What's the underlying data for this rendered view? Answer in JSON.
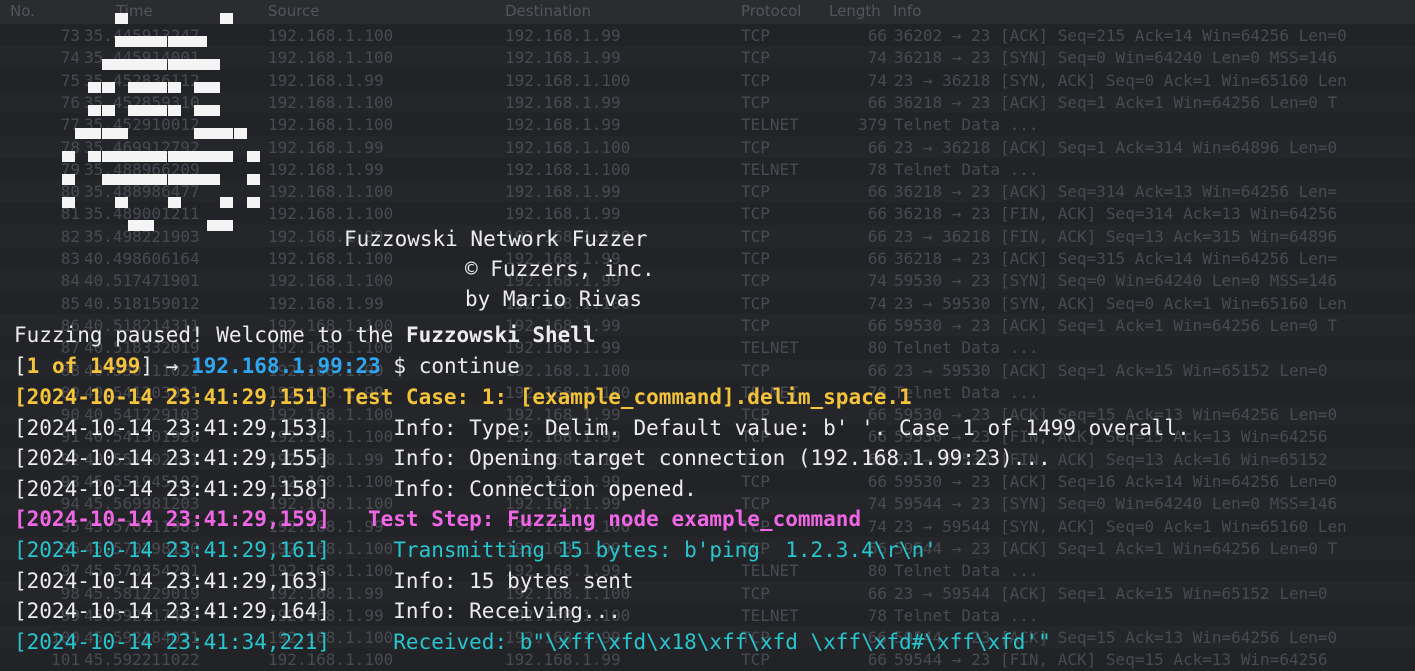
{
  "background": {
    "columns": [
      "No.",
      "Time",
      "Source",
      "Destination",
      "Protocol",
      "Length",
      "Info"
    ],
    "rows": [
      {
        "no": "73",
        "time": "35.445913247",
        "src": "192.168.1.100",
        "dst": "192.168.1.99",
        "proto": "TCP",
        "len": "66",
        "info": "36202 → 23 [ACK] Seq=215 Ack=14 Win=64256 Len=0"
      },
      {
        "no": "74",
        "time": "35.445914001",
        "src": "192.168.1.100",
        "dst": "192.168.1.99",
        "proto": "TCP",
        "len": "74",
        "info": "36218 → 23 [SYN] Seq=0 Win=64240 Len=0 MSS=146"
      },
      {
        "no": "75",
        "time": "35.452836112",
        "src": "192.168.1.99",
        "dst": "192.168.1.100",
        "proto": "TCP",
        "len": "74",
        "info": "23 → 36218 [SYN, ACK] Seq=0 Ack=1 Win=65160 Len"
      },
      {
        "no": "76",
        "time": "35.452859310",
        "src": "192.168.1.100",
        "dst": "192.168.1.99",
        "proto": "TCP",
        "len": "66",
        "info": "36218 → 23 [ACK] Seq=1 Ack=1 Win=64256 Len=0 T"
      },
      {
        "no": "77",
        "time": "35.452910012",
        "src": "192.168.1.100",
        "dst": "192.168.1.99",
        "proto": "TELNET",
        "len": "379",
        "info": "Telnet Data ..."
      },
      {
        "no": "78",
        "time": "35.469912792",
        "src": "192.168.1.99",
        "dst": "192.168.1.100",
        "proto": "TCP",
        "len": "66",
        "info": "23 → 36218 [ACK] Seq=1 Ack=314 Win=64896 Len=0"
      },
      {
        "no": "79",
        "time": "35.488966209",
        "src": "192.168.1.99",
        "dst": "192.168.1.100",
        "proto": "TELNET",
        "len": "78",
        "info": "Telnet Data ..."
      },
      {
        "no": "80",
        "time": "35.488986477",
        "src": "192.168.1.100",
        "dst": "192.168.1.99",
        "proto": "TCP",
        "len": "66",
        "info": "36218 → 23 [ACK] Seq=314 Ack=13 Win=64256 Len="
      },
      {
        "no": "81",
        "time": "35.489001211",
        "src": "192.168.1.100",
        "dst": "192.168.1.99",
        "proto": "TCP",
        "len": "66",
        "info": "36218 → 23 [FIN, ACK] Seq=314 Ack=13 Win=64256"
      },
      {
        "no": "82",
        "time": "35.498221903",
        "src": "192.168.1.99",
        "dst": "192.168.1.100",
        "proto": "TCP",
        "len": "66",
        "info": "23 → 36218 [FIN, ACK] Seq=13 Ack=315 Win=64896"
      },
      {
        "no": "83",
        "time": "40.498606164",
        "src": "192.168.1.100",
        "dst": "192.168.1.99",
        "proto": "TCP",
        "len": "66",
        "info": "36218 → 23 [ACK] Seq=315 Ack=14 Win=64256 Len="
      },
      {
        "no": "84",
        "time": "40.517471901",
        "src": "192.168.1.100",
        "dst": "192.168.1.99",
        "proto": "TCP",
        "len": "74",
        "info": "59530 → 23 [SYN] Seq=0 Win=64240 Len=0 MSS=146"
      },
      {
        "no": "85",
        "time": "40.518159012",
        "src": "192.168.1.99",
        "dst": "192.168.1.100",
        "proto": "TCP",
        "len": "74",
        "info": "23 → 59530 [SYN, ACK] Seq=0 Ack=1 Win=65160 Len"
      },
      {
        "no": "86",
        "time": "40.518214311",
        "src": "192.168.1.100",
        "dst": "192.168.1.99",
        "proto": "TCP",
        "len": "66",
        "info": "59530 → 23 [ACK] Seq=1 Ack=1 Win=64256 Len=0 T"
      },
      {
        "no": "87",
        "time": "40.518332019",
        "src": "192.168.1.100",
        "dst": "192.168.1.99",
        "proto": "TELNET",
        "len": "80",
        "info": "Telnet Data ..."
      },
      {
        "no": "88",
        "time": "40.530111021",
        "src": "192.168.1.99",
        "dst": "192.168.1.100",
        "proto": "TCP",
        "len": "66",
        "info": "23 → 59530 [ACK] Seq=1 Ack=15 Win=65152 Len=0"
      },
      {
        "no": "89",
        "time": "40.541203911",
        "src": "192.168.1.99",
        "dst": "192.168.1.100",
        "proto": "TELNET",
        "len": "78",
        "info": "Telnet Data ..."
      },
      {
        "no": "90",
        "time": "40.541229103",
        "src": "192.168.1.100",
        "dst": "192.168.1.99",
        "proto": "TCP",
        "len": "66",
        "info": "59530 → 23 [ACK] Seq=15 Ack=13 Win=64256 Len=0"
      },
      {
        "no": "91",
        "time": "40.541301928",
        "src": "192.168.1.100",
        "dst": "192.168.1.99",
        "proto": "TCP",
        "len": "66",
        "info": "59530 → 23 [FIN, ACK] Seq=15 Ack=13 Win=64256"
      },
      {
        "no": "92",
        "time": "40.551902111",
        "src": "192.168.1.99",
        "dst": "192.168.1.100",
        "proto": "TCP",
        "len": "66",
        "info": "23 → 59530 [FIN, ACK] Seq=13 Ack=16 Win=65152"
      },
      {
        "no": "93",
        "time": "45.551945102",
        "src": "192.168.1.100",
        "dst": "192.168.1.99",
        "proto": "TCP",
        "len": "66",
        "info": "59530 → 23 [ACK] Seq=16 Ack=14 Win=64256 Len=0"
      },
      {
        "no": "94",
        "time": "45.569981203",
        "src": "192.168.1.100",
        "dst": "192.168.1.99",
        "proto": "TCP",
        "len": "74",
        "info": "59544 → 23 [SYN] Seq=0 Win=64240 Len=0 MSS=146"
      },
      {
        "no": "95",
        "time": "45.570211983",
        "src": "192.168.1.99",
        "dst": "192.168.1.100",
        "proto": "TCP",
        "len": "74",
        "info": "23 → 59544 [SYN, ACK] Seq=0 Ack=1 Win=65160 Len"
      },
      {
        "no": "96",
        "time": "45.570298110",
        "src": "192.168.1.100",
        "dst": "192.168.1.99",
        "proto": "TCP",
        "len": "66",
        "info": "59544 → 23 [ACK] Seq=1 Ack=1 Win=64256 Len=0 T"
      },
      {
        "no": "97",
        "time": "45.570354201",
        "src": "192.168.1.100",
        "dst": "192.168.1.99",
        "proto": "TELNET",
        "len": "80",
        "info": "Telnet Data ..."
      },
      {
        "no": "98",
        "time": "45.581229019",
        "src": "192.168.1.99",
        "dst": "192.168.1.100",
        "proto": "TCP",
        "len": "66",
        "info": "23 → 59544 [ACK] Seq=1 Ack=15 Win=65152 Len=0"
      },
      {
        "no": "99",
        "time": "45.592117403",
        "src": "192.168.1.99",
        "dst": "192.168.1.100",
        "proto": "TELNET",
        "len": "78",
        "info": "Telnet Data ..."
      },
      {
        "no": "100",
        "time": "45.592184021",
        "src": "192.168.1.100",
        "dst": "192.168.1.99",
        "proto": "TCP",
        "len": "66",
        "info": "59544 → 23 [ACK] Seq=15 Ack=13 Win=64256 Len=0"
      },
      {
        "no": "101",
        "time": "45.592211022",
        "src": "192.168.1.100",
        "dst": "192.168.1.99",
        "proto": "TCP",
        "len": "66",
        "info": "59544 → 23 [FIN, ACK] Seq=15 Ack=13 Win=64256"
      }
    ]
  },
  "banner": {
    "title": "Fuzzowski Network Fuzzer",
    "company": "© Fuzzers, inc.",
    "author": "by Mario Rivas"
  },
  "shell": {
    "paused_prefix": "Fuzzing paused! Welcome to the ",
    "shell_name": "Fuzzowski Shell",
    "prompt_progress": "1 of 1499",
    "prompt_arrow": "→",
    "prompt_target": "192.168.1.99:23",
    "prompt_symbol": "$",
    "command": "continue"
  },
  "log": [
    {
      "ts": "[2024-10-14 23:41:29,151]",
      "msg": " Test Case: 1: [example_command].delim_space.1",
      "color": "#f3c33b",
      "bold": true
    },
    {
      "ts": "[2024-10-14 23:41:29,153]",
      "msg": "     Info: Type: Delim. Default value: b' '. Case 1 of 1499 overall.",
      "color": "#ececec",
      "bold": false
    },
    {
      "ts": "[2024-10-14 23:41:29,155]",
      "msg": "     Info: Opening target connection (192.168.1.99:23)...",
      "color": "#ececec",
      "bold": false
    },
    {
      "ts": "[2024-10-14 23:41:29,158]",
      "msg": "     Info: Connection opened.",
      "color": "#ececec",
      "bold": false
    },
    {
      "ts": "[2024-10-14 23:41:29,159]",
      "msg": "   Test Step: Fuzzing node example_command",
      "color": "#f067e6",
      "bold": true
    },
    {
      "ts": "[2024-10-14 23:41:29,161]",
      "msg": "     Transmitting 15 bytes: b'ping  1.2.3.4\\r\\n'",
      "color": "#27c6cf",
      "bold": false
    },
    {
      "ts": "[2024-10-14 23:41:29,163]",
      "msg": "     Info: 15 bytes sent",
      "color": "#ececec",
      "bold": false
    },
    {
      "ts": "[2024-10-14 23:41:29,164]",
      "msg": "     Info: Receiving...",
      "color": "#ececec",
      "bold": false
    },
    {
      "ts": "[2024-10-14 23:41:34,221]",
      "msg": "     Received: b\"\\xff\\xfd\\x18\\xff\\xfd \\xff\\xfd#\\xff\\xfd'\"",
      "color": "#27c6cf",
      "bold": false
    }
  ],
  "colors": {
    "background": "#222326",
    "yellow": "#f3c33b",
    "pink": "#f067e6",
    "cyan": "#27c6cf",
    "blue": "#2ea6f0",
    "text": "#ececec"
  }
}
